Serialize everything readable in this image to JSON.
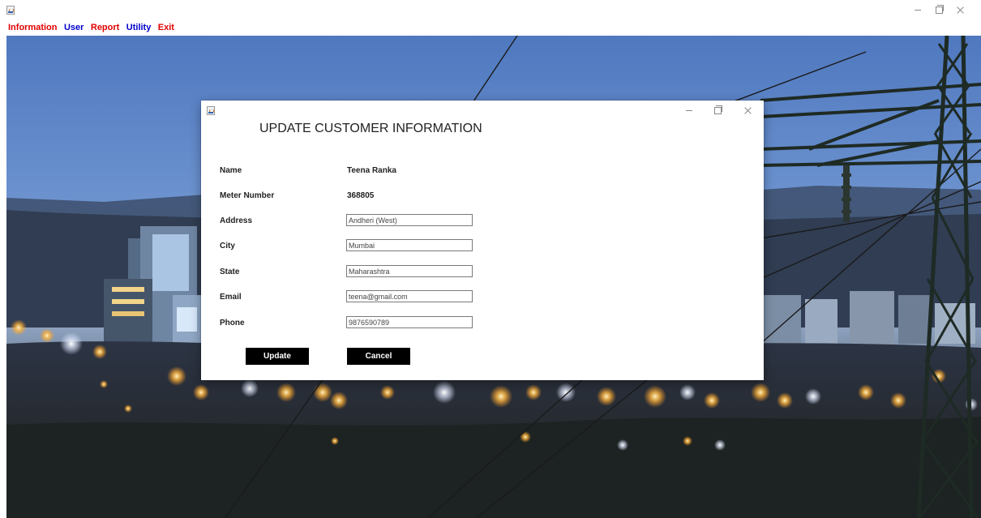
{
  "main_window": {
    "title": ""
  },
  "menu": {
    "items": [
      {
        "label": "Information",
        "color": "#e00000"
      },
      {
        "label": "User",
        "color": "#0000cc"
      },
      {
        "label": "Report",
        "color": "#e00000"
      },
      {
        "label": "Utility",
        "color": "#0000cc"
      },
      {
        "label": "Exit",
        "color": "#e00000"
      }
    ]
  },
  "dialog": {
    "title": "UPDATE CUSTOMER INFORMATION",
    "fields": {
      "name": {
        "label": "Name",
        "value": "Teena Ranka"
      },
      "meter_number": {
        "label": "Meter Number",
        "value": "368805"
      },
      "address": {
        "label": "Address",
        "value": "Andheri (West)"
      },
      "city": {
        "label": "City",
        "value": "Mumbai"
      },
      "state": {
        "label": "State",
        "value": "Maharashtra"
      },
      "email": {
        "label": "Email",
        "value": "teena@gmail.com"
      },
      "phone": {
        "label": "Phone",
        "value": "9876590789"
      }
    },
    "buttons": {
      "update": "Update",
      "cancel": "Cancel"
    }
  },
  "colors": {
    "menu_red": "#e00000",
    "menu_blue": "#0000cc",
    "button_bg": "#000000",
    "button_fg": "#ffffff"
  }
}
